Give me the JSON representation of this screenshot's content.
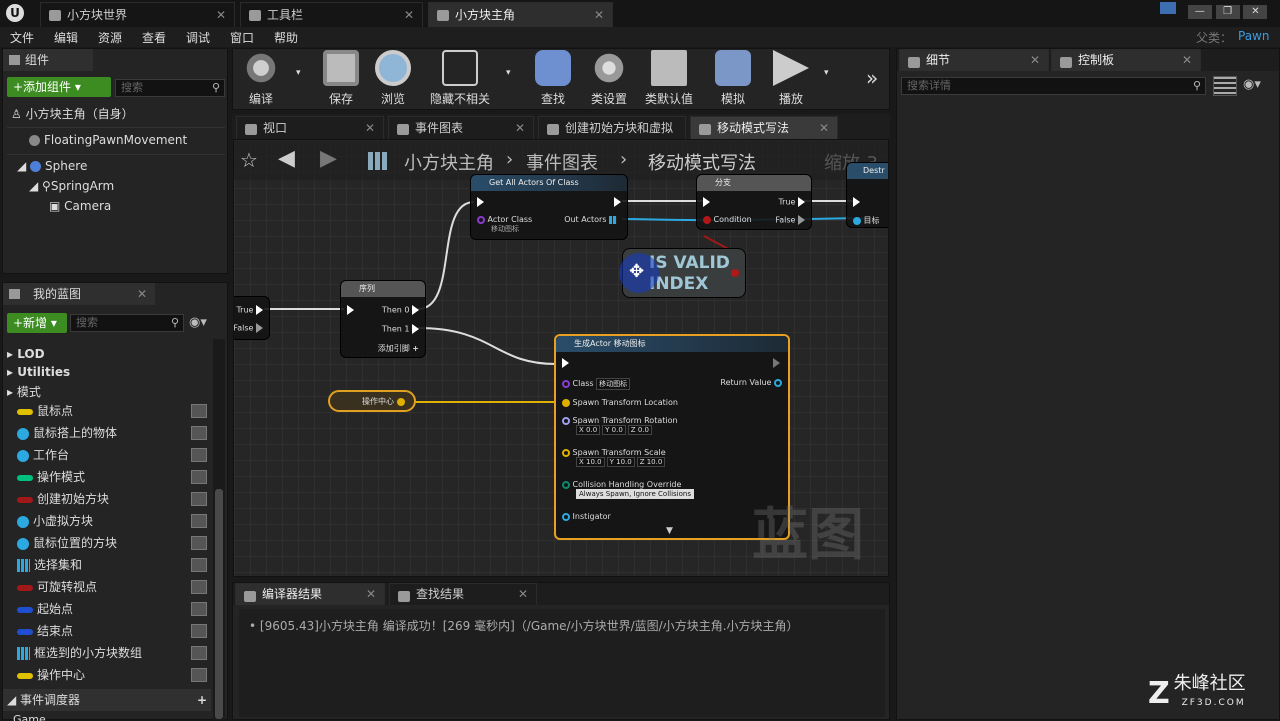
{
  "titlebar": {
    "tabs": [
      "小方块世界",
      "工具栏",
      "小方块主角"
    ],
    "parent_label": "父类：",
    "parent_value": "Pawn"
  },
  "menus": [
    "文件",
    "编辑",
    "资源",
    "查看",
    "调试",
    "窗口",
    "帮助"
  ],
  "components": {
    "panel_title": "组件",
    "add_button": "+添加组件",
    "search_placeholder": "搜索",
    "self": "小方块主角（自身）",
    "items": [
      "FloatingPawnMovement",
      "Sphere",
      "SpringArm",
      "Camera"
    ]
  },
  "my_blueprint": {
    "panel_title": "我的蓝图",
    "new_button": "+新增",
    "search_placeholder": "搜索",
    "categories": [
      "LOD",
      "Utilities",
      "模式"
    ],
    "variables": [
      {
        "name": "鼠标点",
        "kind": "pill",
        "color": "#e0c000"
      },
      {
        "name": "鼠标搭上的物体",
        "kind": "dot",
        "color": "#2ba9e0"
      },
      {
        "name": "工作台",
        "kind": "dot",
        "color": "#2ba9e0"
      },
      {
        "name": "操作模式",
        "kind": "pill",
        "color": "#00c080"
      },
      {
        "name": "创建初始方块",
        "kind": "pill",
        "color": "#a01818"
      },
      {
        "name": "小虚拟方块",
        "kind": "dot",
        "color": "#2ba9e0"
      },
      {
        "name": "鼠标位置的方块",
        "kind": "dot",
        "color": "#2ba9e0"
      },
      {
        "name": "选择集和",
        "kind": "grid",
        "color": "#2ba9e0"
      },
      {
        "name": "可旋转视点",
        "kind": "pill",
        "color": "#a01818"
      },
      {
        "name": "起始点",
        "kind": "pill",
        "color": "#1f4fd0"
      },
      {
        "name": "结束点",
        "kind": "pill",
        "color": "#1f4fd0"
      },
      {
        "name": "框选到的小方块数组",
        "kind": "grid",
        "color": "#2ba9e0"
      },
      {
        "name": "操作中心",
        "kind": "pill",
        "color": "#e0c000"
      }
    ],
    "event_dispatcher": "事件调度器",
    "bottom_item": "Game"
  },
  "toolbar": {
    "buttons": [
      "编译",
      "保存",
      "浏览",
      "隐藏不相关",
      "查找",
      "类设置",
      "类默认值",
      "模拟",
      "播放"
    ],
    "more": "»"
  },
  "editor_tabs": [
    "视口",
    "事件图表",
    "创建初始方块和虚拟",
    "移动模式写法"
  ],
  "breadcrumb": {
    "root": "小方块主角",
    "mid": "事件图表",
    "leaf": "移动模式写法",
    "zoom": "缩放-3"
  },
  "graph": {
    "watermark": "蓝图",
    "nodes": {
      "get_all_actors": {
        "title": "Get All Actors Of Class",
        "actor_class": "Actor Class",
        "class_value": "移动图标",
        "out_actors": "Out Actors"
      },
      "branch": {
        "title": "分支",
        "condition": "Condition",
        "true": "True",
        "false": "False"
      },
      "destroy": {
        "title": "Destr",
        "target": "目标"
      },
      "is_valid": {
        "line1": "IS VALID",
        "line2": "INDEX"
      },
      "sequence": {
        "title": "序列",
        "then0": "Then 0",
        "then1": "Then 1",
        "add_pin": "添加引脚"
      },
      "left_branch": {
        "true": "True",
        "false": "False"
      },
      "spawn": {
        "title": "生成Actor 移动图标",
        "class_label": "Class",
        "class_value": "移动图标",
        "return_value": "Return Value",
        "location": "Spawn Transform Location",
        "rotation": "Spawn Transform Rotation",
        "rotation_values": [
          "X 0.0",
          "Y 0.0",
          "Z 0.0"
        ],
        "scale": "Spawn Transform Scale",
        "scale_values": [
          "X 10.0",
          "Y 10.0",
          "Z 10.0"
        ],
        "collision": "Collision Handling Override",
        "collision_value": "Always Spawn, Ignore Collisions",
        "instigator": "Instigator"
      },
      "operation_center": {
        "label": "操作中心"
      }
    }
  },
  "details": {
    "tab1": "细节",
    "tab2": "控制板",
    "search_placeholder": "搜索详情"
  },
  "bottom_tabs": [
    "编译器结果",
    "查找结果"
  ],
  "log_line": "[9605.43]小方块主角 编译成功！[269 毫秒内]（/Game/小方块世界/蓝图/小方块主角.小方块主角）",
  "watermark": {
    "brand": "朱峰社区",
    "site": "ZF3D.COM"
  }
}
